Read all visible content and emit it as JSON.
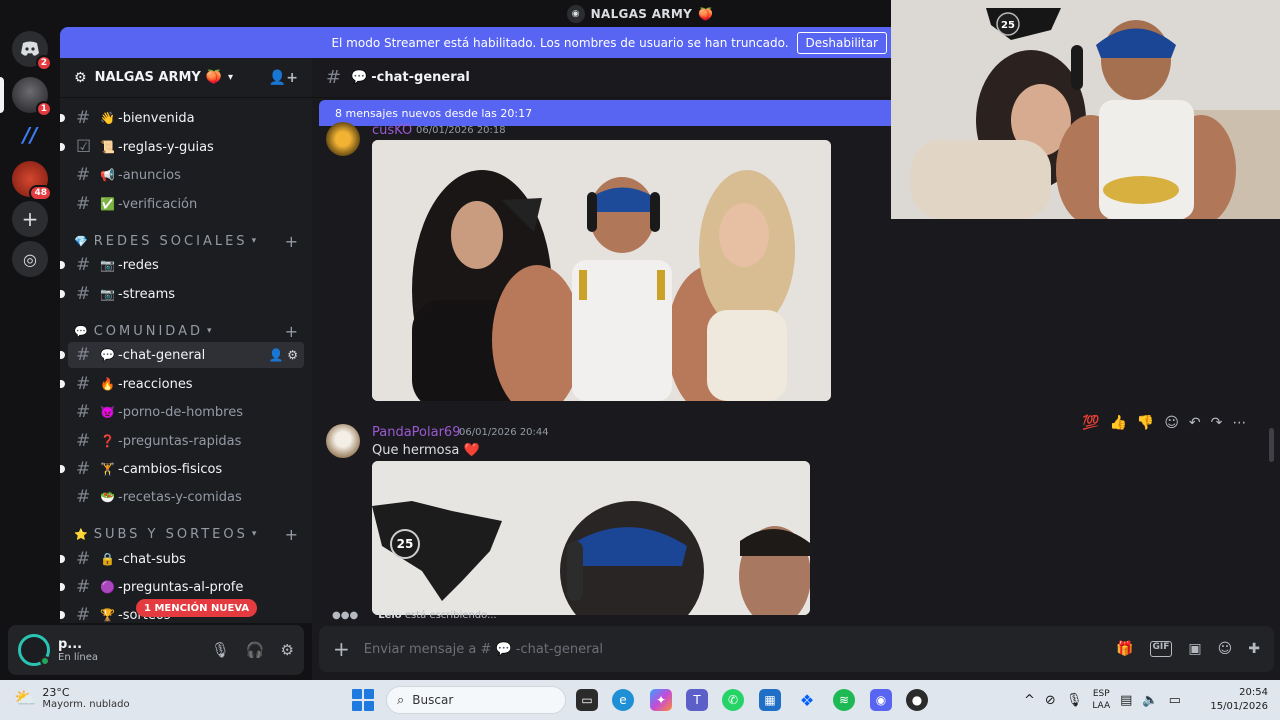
{
  "window": {
    "title": "NALGAS ARMY",
    "title_emoji": "🍑"
  },
  "rail": {
    "servers": [
      {
        "name": "discord-home",
        "badge": "2"
      },
      {
        "name": "server-avatar",
        "badge": "1"
      },
      {
        "name": "server-blue",
        "badge": ""
      },
      {
        "name": "server-red",
        "badge": "48"
      }
    ]
  },
  "banner": {
    "text": "El modo Streamer está habilitado. Los nombres de usuario se han truncado.",
    "button": "Deshabilitar"
  },
  "server": {
    "name": "NALGAS ARMY",
    "emoji": "🍑"
  },
  "categories": [
    {
      "label": "Redes sociales",
      "icon": "💎"
    },
    {
      "label": "Comunidad",
      "icon": "💬"
    },
    {
      "label": "Subs y sorteos",
      "icon": "⭐"
    }
  ],
  "channels": [
    {
      "emoji": "👋",
      "name": "-bienvenida"
    },
    {
      "emoji": "📜",
      "name": "-reglas-y-guias"
    },
    {
      "emoji": "📢",
      "name": "-anuncios"
    },
    {
      "emoji": "✅",
      "name": "-verificación"
    },
    {
      "emoji": "📷",
      "name": "-redes"
    },
    {
      "emoji": "📷",
      "name": "-streams"
    },
    {
      "emoji": "💬",
      "name": "-chat-general"
    },
    {
      "emoji": "🔥",
      "name": "-reacciones"
    },
    {
      "emoji": "👿",
      "name": "-porno-de-hombres"
    },
    {
      "emoji": "❓",
      "name": "-preguntas-rapidas"
    },
    {
      "emoji": "🏋",
      "name": "-cambios-fisicos"
    },
    {
      "emoji": "🥗",
      "name": "-recetas-y-comidas"
    },
    {
      "emoji": "🔒",
      "name": "-chat-subs"
    },
    {
      "emoji": "🟣",
      "name": "-preguntas-al-profe"
    },
    {
      "emoji": "🏆",
      "name": "-sorteos"
    }
  ],
  "mention_pill": "1 MENCIÓN NUEVA",
  "user": {
    "name": "p...",
    "status": "En línea"
  },
  "chat": {
    "channel_emoji": "💬",
    "channel": "-chat-general",
    "new_messages": "8 mensajes nuevos desde las 20:17",
    "messages": [
      {
        "author": "cusKO",
        "time": "06/01/2026 20:18",
        "text": ""
      },
      {
        "author": "PandaPolar69",
        "time": "06/01/2026 20:44",
        "text": "Que hermosa",
        "emoji": "❤️"
      }
    ],
    "typing_user": "Lelo",
    "typing_text": "está escribiendo...",
    "placeholder": "Enviar mensaje a # 💬 -chat-general",
    "reactions": [
      "💯",
      "👍",
      "👎"
    ]
  },
  "webcam": {
    "jersey_number": "25"
  },
  "photo2": {
    "jersey_number": "25"
  },
  "taskbar": {
    "weather_temp": "23°C",
    "weather_desc": "Mayorm. nublado",
    "search": "Buscar",
    "lang_top": "ESP",
    "lang_bottom": "LAA",
    "time": "20:54",
    "date": "15/01/2026"
  },
  "colors": {
    "blurple": "#5865f2",
    "mention": "#e33b3f",
    "author": "#9b59d0",
    "online": "#23a55a"
  }
}
